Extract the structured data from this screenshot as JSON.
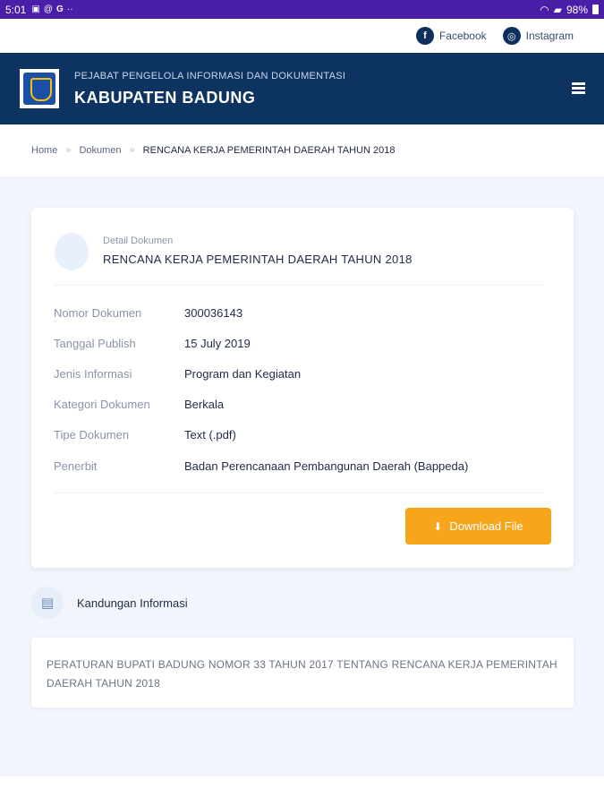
{
  "status_bar": {
    "time": "5:01",
    "left_icons": [
      "gallery-icon",
      "email-icon",
      "google-icon",
      "more-dots-icon"
    ],
    "battery": "98%"
  },
  "social": {
    "facebook": "Facebook",
    "instagram": "Instagram"
  },
  "header": {
    "subtitle": "PEJABAT PENGELOLA INFORMASI DAN DOKUMENTASI",
    "title": "KABUPATEN BADUNG",
    "brand_color": "#0d3461"
  },
  "breadcrumb": {
    "items": [
      "Home",
      "Dokumen",
      "RENCANA KERJA PEMERINTAH DAERAH TAHUN 2018"
    ],
    "separator": "»"
  },
  "detail": {
    "label": "Detail Dokumen",
    "title": "RENCANA KERJA PEMERINTAH DAERAH TAHUN 2018",
    "fields": [
      {
        "key": "Nomor Dokumen",
        "value": "300036143"
      },
      {
        "key": "Tanggal Publish",
        "value": "15 July 2019"
      },
      {
        "key": "Jenis Informasi",
        "value": "Program dan Kegiatan"
      },
      {
        "key": "Kategori Dokumen",
        "value": "Berkala"
      },
      {
        "key": "Tipe Dokumen",
        "value": "Text (.pdf)"
      },
      {
        "key": "Penerbit",
        "value": "Badan Perencanaan Pembangunan Daerah (Bappeda)"
      }
    ],
    "download_label": "Download File",
    "accent_color": "#f7a51b"
  },
  "kandungan": {
    "label": "Kandungan Informasi",
    "text": "PERATURAN BUPATI BADUNG NOMOR 33 TAHUN 2017 TENTANG RENCANA KERJA PEMERINTAH DAERAH TAHUN 2018"
  }
}
